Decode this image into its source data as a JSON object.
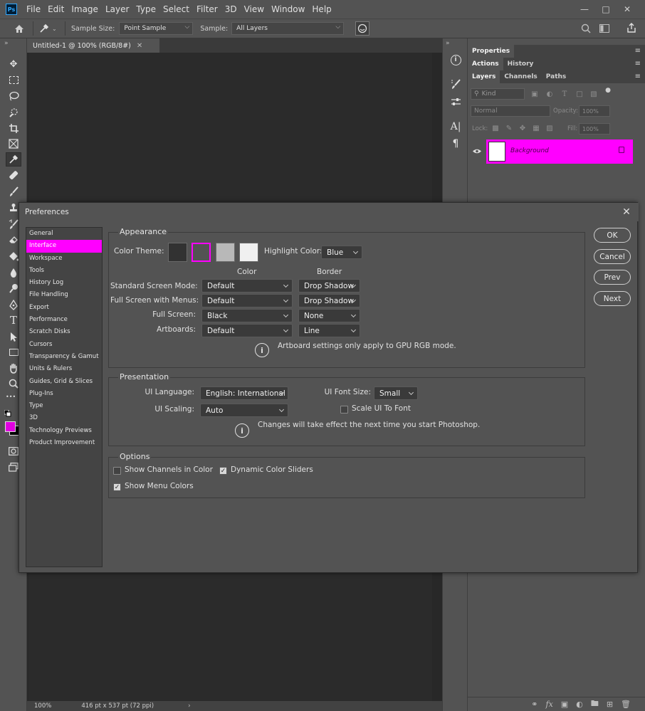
{
  "app": {
    "logo_text": "Ps"
  },
  "menubar": {
    "items": [
      "File",
      "Edit",
      "Image",
      "Layer",
      "Type",
      "Select",
      "Filter",
      "3D",
      "View",
      "Window",
      "Help"
    ]
  },
  "options_bar": {
    "sample_size_label": "Sample Size:",
    "sample_size_value": "Point Sample",
    "sample_label": "Sample:",
    "sample_value": "All Layers"
  },
  "document": {
    "tab_title": "Untitled-1 @ 100% (RGB/8#)",
    "zoom": "100%",
    "dimensions": "416 pt x 537 pt (72 ppi)"
  },
  "panels": {
    "properties_tab": "Properties",
    "tabs_row2": [
      "Actions",
      "History"
    ],
    "tabs_row3": [
      "Layers",
      "Channels",
      "Paths"
    ],
    "kind_placeholder": "Kind",
    "blend_mode": "Normal",
    "opacity_label": "Opacity:",
    "opacity_value": "100%",
    "lock_label": "Lock:",
    "fill_label": "Fill:",
    "fill_value": "100%",
    "layer_name": "Background"
  },
  "dialog": {
    "title": "Preferences",
    "nav": [
      "General",
      "Interface",
      "Workspace",
      "Tools",
      "History Log",
      "File Handling",
      "Export",
      "Performance",
      "Scratch Disks",
      "Cursors",
      "Transparency & Gamut",
      "Units & Rulers",
      "Guides, Grid & Slices",
      "Plug-Ins",
      "Type",
      "3D",
      "Technology Previews",
      "Product Improvement"
    ],
    "active_nav": "Interface",
    "appearance": {
      "title": "Appearance",
      "color_theme_label": "Color Theme:",
      "theme_colors": [
        "#323232",
        "#535353",
        "#b8b8b8",
        "#f0f0f0"
      ],
      "selected_theme_index": 1,
      "highlight_label": "Highlight Color:",
      "highlight_value": "Blue",
      "col_color": "Color",
      "col_border": "Border",
      "rows": [
        {
          "label": "Standard Screen Mode:",
          "color": "Default",
          "border": "Drop Shadow"
        },
        {
          "label": "Full Screen with Menus:",
          "color": "Default",
          "border": "Drop Shadow"
        },
        {
          "label": "Full Screen:",
          "color": "Black",
          "border": "None"
        },
        {
          "label": "Artboards:",
          "color": "Default",
          "border": "Line"
        }
      ],
      "note": "Artboard settings only apply to GPU RGB mode."
    },
    "presentation": {
      "title": "Presentation",
      "ui_language_label": "UI Language:",
      "ui_language_value": "English: International",
      "ui_font_size_label": "UI Font Size:",
      "ui_font_size_value": "Small",
      "ui_scaling_label": "UI Scaling:",
      "ui_scaling_value": "Auto",
      "scale_ui_label": "Scale UI To Font",
      "scale_ui_checked": false,
      "note": "Changes will take effect the next time you start Photoshop."
    },
    "options": {
      "title": "Options",
      "show_channels_label": "Show Channels in Color",
      "show_channels_checked": false,
      "dynamic_sliders_label": "Dynamic Color Sliders",
      "dynamic_sliders_checked": true,
      "show_menu_colors_label": "Show Menu Colors",
      "show_menu_colors_checked": true
    },
    "buttons": {
      "ok": "OK",
      "cancel": "Cancel",
      "prev": "Prev",
      "next": "Next"
    }
  },
  "colors": {
    "highlight": "#ff00ff",
    "foreground_swatch": "#e000e0"
  }
}
